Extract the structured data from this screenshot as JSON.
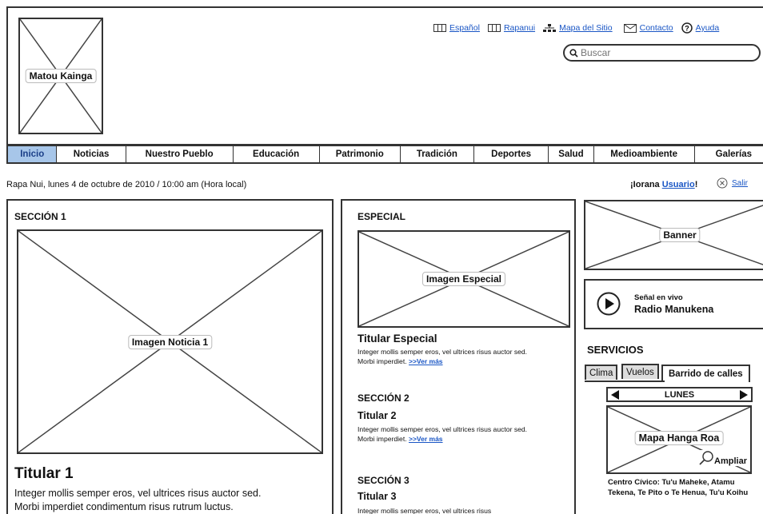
{
  "header": {
    "logo_label": "Matou Kainga",
    "links": [
      {
        "label": "Español",
        "icon": "book-icon"
      },
      {
        "label": "Rapanui",
        "icon": "book-icon"
      },
      {
        "label": "Mapa del Sitio",
        "icon": "sitemap-icon"
      },
      {
        "label": "Contacto",
        "icon": "envelope-icon"
      },
      {
        "label": "Ayuda",
        "icon": "help-icon"
      }
    ],
    "search_placeholder": "Buscar"
  },
  "nav": {
    "items": [
      {
        "label": "Inicio",
        "active": true
      },
      {
        "label": "Noticias"
      },
      {
        "label": "Nuestro Pueblo"
      },
      {
        "label": "Educación"
      },
      {
        "label": "Patrimonio"
      },
      {
        "label": "Tradición"
      },
      {
        "label": "Deportes"
      },
      {
        "label": "Salud"
      },
      {
        "label": "Medioambiente"
      },
      {
        "label": "Galerías"
      }
    ]
  },
  "status": {
    "dateline": "Rapa Nui, lunes 4 de octubre de 2010 / 10:00 am (Hora local)",
    "greet_prefix": "¡Iorana ",
    "user_link": "Usuario",
    "greet_suffix": "!",
    "logout": "Salir"
  },
  "col1": {
    "title": "SECCIÓN 1",
    "image_label": "Imagen Noticia 1",
    "headline": "Titular 1",
    "body_line1": "Integer mollis semper eros, vel ultrices risus auctor sed.",
    "body_line2": "Morbi imperdiet condimentum risus rutrum luctus."
  },
  "col2": {
    "title": "ESPECIAL",
    "image_label": "Imagen Especial",
    "special_headline": "Titular Especial",
    "special_text": "Integer mollis semper eros, vel ultrices risus auctor sed. Morbi imperdiet.",
    "more": ">>Ver más",
    "sec2_title": "SECCIÓN 2",
    "sec2_headline": "Titular 2",
    "sec2_text": "Integer mollis semper eros, vel ultrices risus auctor sed. Morbi imperdiet.",
    "sec3_title": "SECCIÓN 3",
    "sec3_headline": "Titular 3",
    "sec3_text": "Integer mollis semper eros, vel ultrices risus"
  },
  "col3": {
    "banner_label": "Banner",
    "radio_line1": "Señal en vivo",
    "radio_line2": "Radio Manukena",
    "services_title": "SERVICIOS",
    "tabs": [
      "Clima",
      "Vuelos",
      "Barrido de calles"
    ],
    "day": "LUNES",
    "map_label": "Mapa Hanga Roa",
    "zoom": "Ampliar",
    "civic_text": "Centro Cívico: Tu'u Maheke, Atamu Tekena, Te Pito o Te Henua, Tu'u Koihu"
  },
  "colors": {
    "accent": "#a7c6e9",
    "link": "#1a56c5",
    "border": "#333333"
  }
}
